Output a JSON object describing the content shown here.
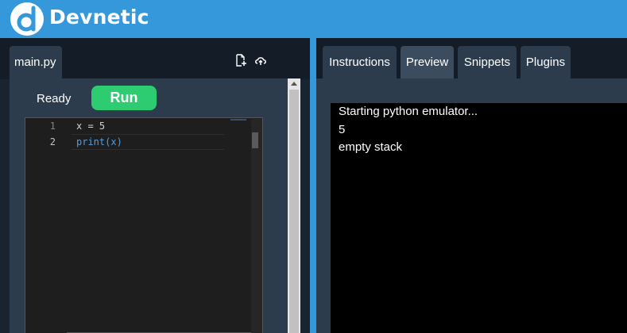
{
  "app": {
    "name": "Devnetic"
  },
  "colors": {
    "brand": "#3598db",
    "run": "#2ecc71",
    "panel": "#2c3c4d"
  },
  "editor_panel": {
    "file_tab": "main.py",
    "icons": [
      "new-file-icon",
      "cloud-upload-icon"
    ],
    "status": "Ready",
    "run_label": "Run",
    "lines": [
      {
        "number": "1",
        "code": "x = 5"
      },
      {
        "number": "2",
        "code": "print(x)"
      }
    ]
  },
  "output_panel": {
    "tabs": [
      "Instructions",
      "Preview",
      "Snippets",
      "Plugins"
    ],
    "active_tab": "Preview",
    "console_lines": [
      "Starting python emulator...",
      "5",
      "empty stack"
    ]
  }
}
